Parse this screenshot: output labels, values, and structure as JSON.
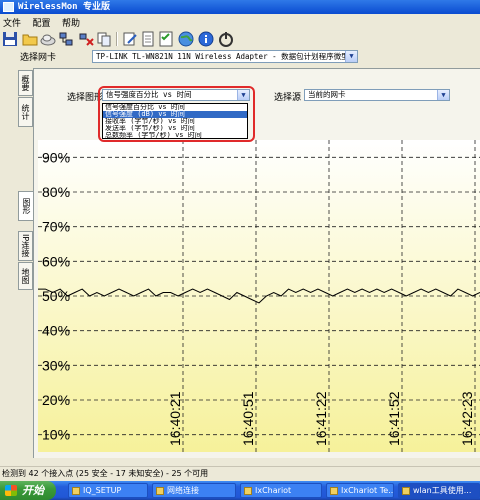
{
  "app": {
    "title": "WirelessMon 专业版"
  },
  "menu": [
    "文件",
    "配置",
    "帮助"
  ],
  "toolbar_icons": [
    "save-icon",
    "open-folder-icon",
    "cloud-icon",
    "network-icon",
    "disconnect-icon",
    "copy-icon",
    "edit-icon",
    "document-icon",
    "checklist-icon",
    "globe-icon",
    "help-icon",
    "power-icon"
  ],
  "nic": {
    "label": "选择网卡",
    "value": "TP-LINK TL-WN821N 11N Wireless Adapter - 数据包计划程序微型端口"
  },
  "sidetabs": [
    {
      "label": "概要",
      "active": false
    },
    {
      "label": "统计",
      "active": false
    },
    {
      "label": "图形",
      "active": true
    },
    {
      "label": "IP连接",
      "active": false
    },
    {
      "label": "地图",
      "active": false
    }
  ],
  "graph_panel": {
    "graph_type_label": "选择图形",
    "graph_type_value": "信号强度百分比 vs 时间",
    "graph_type_options": [
      "信号强度百分比 vs 时间",
      "信号强度 (dB) vs 时间",
      "接收率 (字节/秒) vs 时间",
      "发送率 (字节/秒) vs 时间",
      "总数频率 (字节/秒) vs 时间"
    ],
    "graph_type_selected_index": 1,
    "source_label": "选择源",
    "source_value": "当前的网卡"
  },
  "colors": {
    "chart_top": "#ffffff",
    "chart_bottom": "#f6f19a",
    "grid": "#222222",
    "line": "#000000",
    "highlight": "#e02a2a"
  },
  "chart_data": {
    "type": "line",
    "ylim": [
      5,
      95
    ],
    "yticks": [
      90,
      80,
      70,
      60,
      50,
      40,
      30,
      20,
      10
    ],
    "ytick_labels": [
      "90%",
      "80%",
      "70%",
      "60%",
      "50%",
      "40%",
      "30%",
      "20%",
      "10%"
    ],
    "xtick_labels": [
      "16:40:21",
      "16:40:51",
      "16:41:22",
      "16:41:52",
      "16:42:23"
    ],
    "grid": true,
    "series": [
      {
        "values": [
          52,
          52,
          51,
          52,
          50,
          51,
          52,
          50,
          51,
          50,
          51,
          52,
          51,
          50,
          51,
          52,
          50,
          51,
          51,
          50,
          51,
          52,
          51,
          52,
          51,
          50,
          49,
          51,
          50,
          49,
          48,
          50,
          51,
          50,
          52,
          51,
          52,
          51,
          52,
          51,
          50,
          51,
          52,
          51,
          52,
          51,
          52,
          51,
          52,
          51,
          50,
          51,
          52,
          51,
          52,
          51,
          50,
          52,
          51,
          50,
          51
        ]
      }
    ]
  },
  "status": {
    "text": "检测到 42 个接入点 (25 安全 - 17 未知安全) - 25 个可用"
  },
  "taskbar": {
    "start_label": "开始",
    "tasks": [
      "IQ_SETUP",
      "网络连接",
      "IxChariot",
      "IxChariot Te...",
      "wlan工具使用..."
    ]
  }
}
